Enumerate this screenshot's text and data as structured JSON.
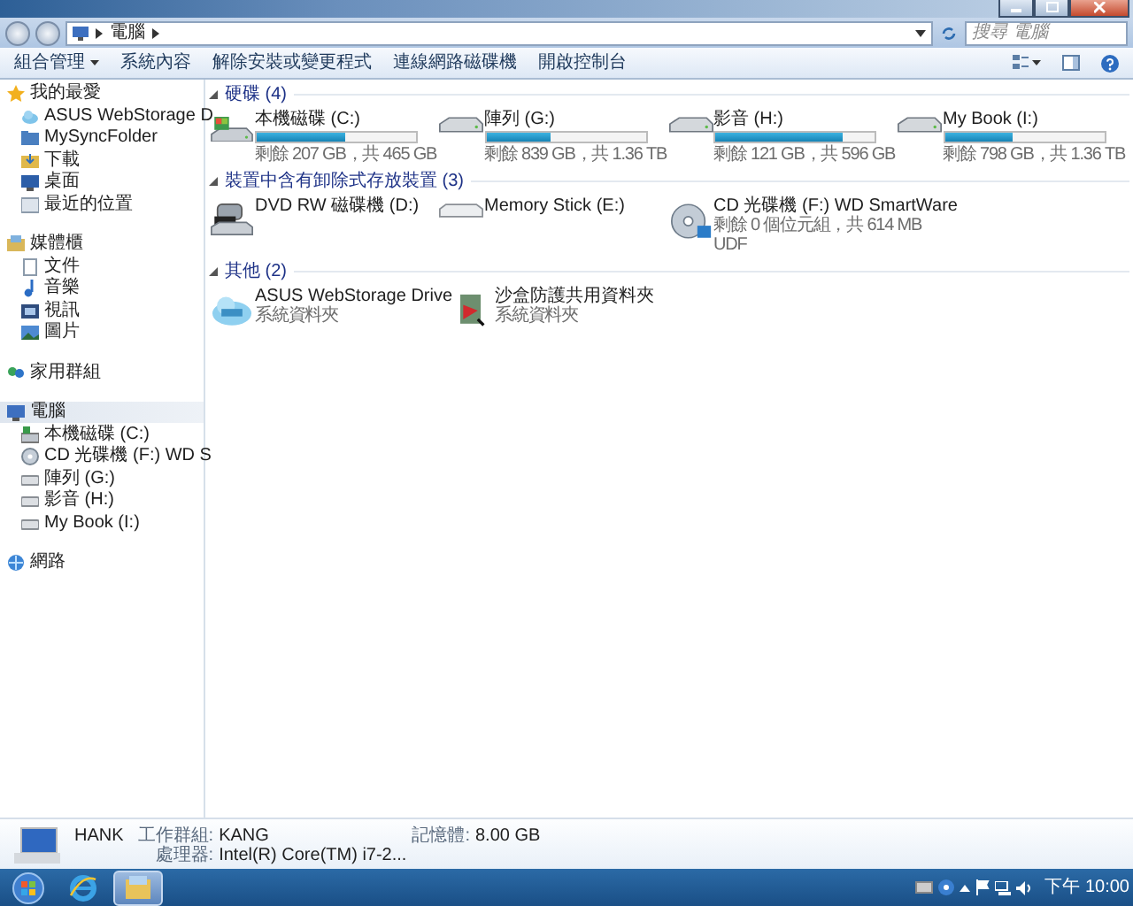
{
  "window": {
    "controls": [
      {
        "kind": "minimize"
      },
      {
        "kind": "maximize"
      },
      {
        "kind": "close"
      }
    ]
  },
  "address_bar": {
    "path": [
      "電腦"
    ],
    "search": {
      "placeholder": "搜尋 電腦"
    }
  },
  "toolbar": {
    "buttons": [
      {
        "label": "組合管理",
        "kind": "menu"
      },
      {
        "label": "系統內容",
        "kind": "plain"
      },
      {
        "label": "解除安裝或變更程式",
        "kind": "plain"
      },
      {
        "label": "連線網路磁碟機",
        "kind": "plain"
      },
      {
        "label": "開啟控制台",
        "kind": "plain"
      }
    ]
  },
  "sidebar": {
    "sections": [
      {
        "label": "我的最愛",
        "kind": "star",
        "selected": false,
        "children": [
          {
            "label": "ASUS WebStorage D",
            "kind": "cloud",
            "selected": false
          },
          {
            "label": "MySyncFolder",
            "kind": "folder",
            "selected": false
          },
          {
            "label": "下載",
            "kind": "download",
            "selected": false
          },
          {
            "label": "桌面",
            "kind": "desktop",
            "selected": false
          },
          {
            "label": "最近的位置",
            "kind": "places",
            "selected": false
          }
        ]
      },
      {
        "label": "媒體櫃",
        "kind": "library",
        "selected": false,
        "children": [
          {
            "label": "文件",
            "kind": "doc",
            "selected": false
          },
          {
            "label": "音樂",
            "kind": "music",
            "selected": false
          },
          {
            "label": "視訊",
            "kind": "video",
            "selected": false
          },
          {
            "label": "圖片",
            "kind": "picture",
            "selected": false
          }
        ]
      },
      {
        "label": "家用群組",
        "kind": "homegroup",
        "selected": false
      },
      {
        "label": "電腦",
        "kind": "computer",
        "selected": true,
        "children": [
          {
            "label": "本機磁碟 (C:)",
            "kind": "sysdrive",
            "selected": false
          },
          {
            "label": "CD 光碟機 (F:) WD S",
            "kind": "cd",
            "selected": false
          },
          {
            "label": "陣列 (G:)",
            "kind": "drive",
            "selected": false
          },
          {
            "label": "影音 (H:)",
            "kind": "drive",
            "selected": false
          },
          {
            "label": "My Book (I:)",
            "kind": "drive",
            "selected": false
          }
        ]
      },
      {
        "label": "網路",
        "kind": "network",
        "selected": false
      }
    ]
  },
  "groups": [
    {
      "title": "硬碟 (4)",
      "items": [
        {
          "name": "本機磁碟 (C:)",
          "kind": "sysdrive",
          "level": 0.56,
          "details": [
            "剩餘 207 GB，共 465 GB"
          ]
        },
        {
          "name": "陣列 (G:)",
          "kind": "drive",
          "level": 0.4,
          "details": [
            "剩餘 839 GB，共 1.36 TB"
          ]
        },
        {
          "name": "影音 (H:)",
          "kind": "drive",
          "level": 0.8,
          "details": [
            "剩餘 121 GB，共 596 GB"
          ]
        },
        {
          "name": "My Book (I:)",
          "kind": "drive",
          "level": 0.43,
          "details": [
            "剩餘 798 GB，共 1.36 TB"
          ]
        }
      ]
    },
    {
      "title": "裝置中含有卸除式存放裝置 (3)",
      "items": [
        {
          "name": "DVD RW 磁碟機 (D:)",
          "kind": "dvd"
        },
        {
          "name": "Memory Stick (E:)",
          "kind": "removable"
        },
        {
          "name": "CD 光碟機 (F:) WD SmartWare",
          "kind": "cd",
          "details": [
            "剩餘 0 個位元組，共 614 MB",
            "UDF"
          ]
        }
      ]
    },
    {
      "title": "其他 (2)",
      "items": [
        {
          "name": "ASUS WebStorage Drive",
          "kind": "cloud",
          "details": [
            "系統資料夾"
          ]
        },
        {
          "name": "沙盒防護共用資料夾",
          "kind": "shared",
          "details": [
            "系統資料夾"
          ]
        }
      ]
    }
  ],
  "details_pane": {
    "computer_name": "HANK",
    "fields": [
      {
        "label": "工作群組:",
        "value": "KANG"
      },
      {
        "label": "記憶體:",
        "value": "8.00 GB"
      },
      {
        "label": "處理器:",
        "value": "Intel(R) Core(TM) i7-2..."
      }
    ]
  },
  "taskbar": {
    "pinned": [
      {
        "kind": "browser",
        "selected": false
      },
      {
        "kind": "explorer",
        "selected": true
      }
    ],
    "clock": "下午 10:00"
  }
}
